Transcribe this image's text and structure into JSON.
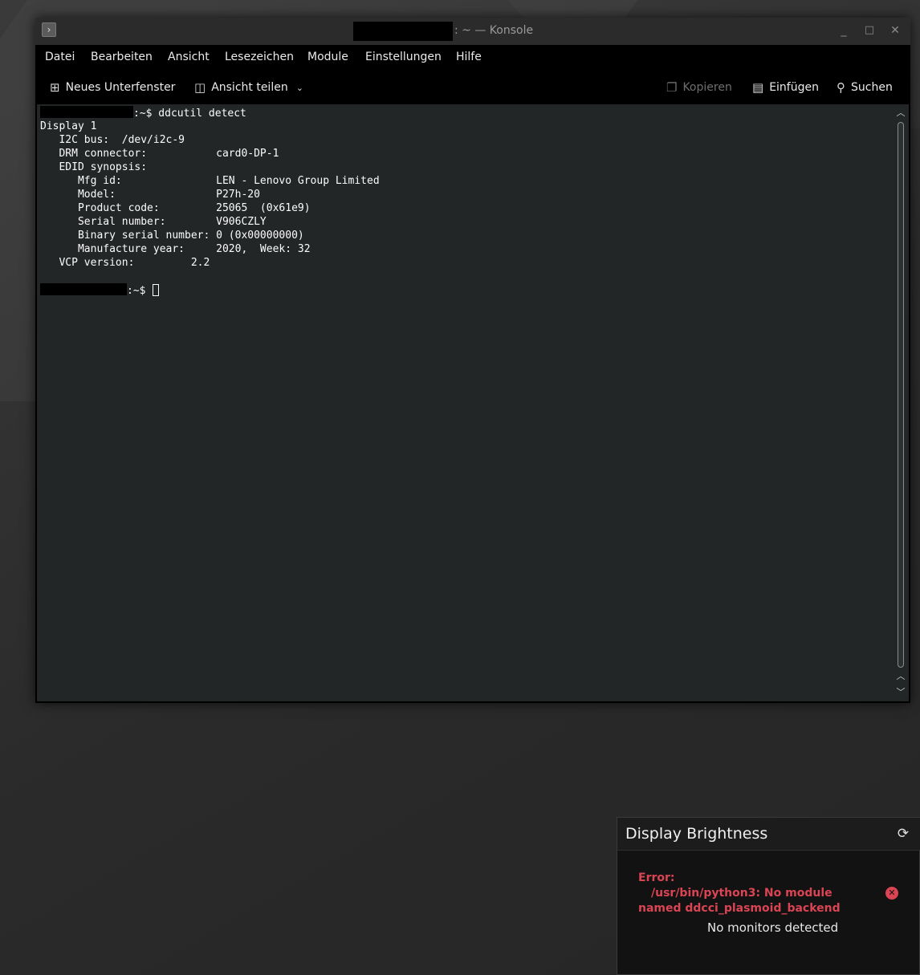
{
  "window": {
    "title": ": ~ — Konsole",
    "minimize_glyph": "_",
    "maximize_glyph": "□",
    "close_glyph": "✕",
    "app_icon": "terminal-icon"
  },
  "menu": {
    "items": [
      "Datei",
      "Bearbeiten",
      "Ansicht",
      "Lesezeichen",
      "Module",
      "Einstellungen",
      "Hilfe"
    ]
  },
  "toolbar": {
    "new_tab": "Neues Unterfenster",
    "split_view": "Ansicht teilen",
    "copy": "Kopieren",
    "paste": "Einfügen",
    "search": "Suchen"
  },
  "terminal": {
    "prompt_suffix": ":~$",
    "command": " ddcutil detect",
    "output": [
      "Display 1",
      "   I2C bus:  /dev/i2c-9",
      "   DRM connector:           card0-DP-1",
      "   EDID synopsis:",
      "      Mfg id:               LEN - Lenovo Group Limited",
      "      Model:                P27h-20",
      "      Product code:         25065  (0x61e9)",
      "      Serial number:        V906CZLY",
      "      Binary serial number: 0 (0x00000000)",
      "      Manufacture year:     2020,  Week: 32",
      "   VCP version:         2.2"
    ],
    "prompt2_suffix": ":~$ "
  },
  "popup": {
    "title": "Display Brightness",
    "error_label": "Error:",
    "error_line1": "/usr/bin/python3: No module",
    "error_line2": "named ddcci_plasmoid_backend",
    "status": "No monitors detected",
    "error_color": "#da4453"
  }
}
